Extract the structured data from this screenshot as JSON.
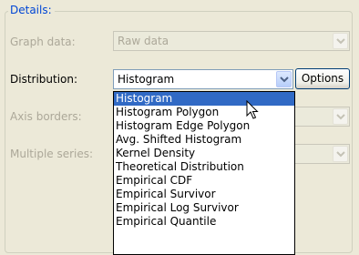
{
  "details": {
    "title": "Details:",
    "graph_data": {
      "label": "Graph data:",
      "value": "Raw data"
    },
    "distribution": {
      "label": "Distribution:",
      "value": "Histogram",
      "options_label": "Options"
    },
    "axis_borders": {
      "label": "Axis borders:"
    },
    "multiple_series": {
      "label": "Multiple series:"
    }
  },
  "distribution_list": [
    "Histogram",
    "Histogram Polygon",
    "Histogram Edge Polygon",
    "Avg. Shifted Histogram",
    "Kernel Density",
    "Theoretical Distribution",
    "Empirical CDF",
    "Empirical Survivor",
    "Empirical Log Survivor",
    "Empirical Quantile"
  ],
  "selected_index": 0,
  "colors": {
    "accent": "#0046d5",
    "selection": "#316ac5",
    "disabled_text": "#aca899"
  },
  "icons": {
    "dropdown": "chevron-down-icon",
    "cursor": "mouse-pointer-icon"
  }
}
